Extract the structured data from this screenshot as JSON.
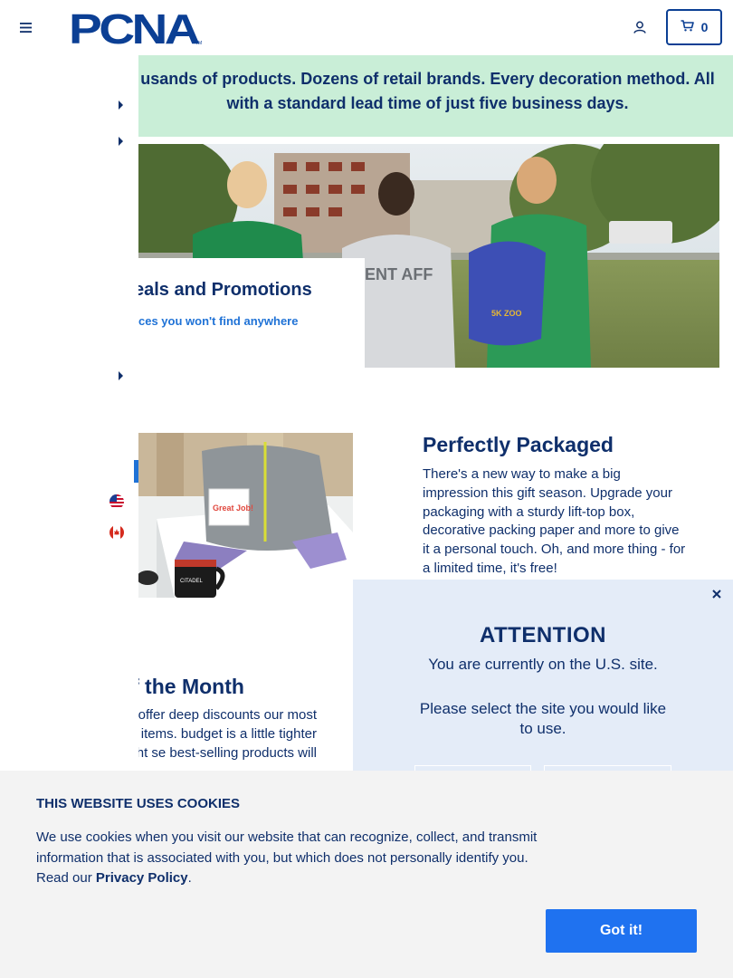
{
  "header": {
    "brand": "PCNA",
    "cart_count": "0"
  },
  "banner": {
    "text": "usands of products. Dozens of retail brands. Every decoration method. All with a standard lead time of just five business days."
  },
  "hero": {
    "card_title": "eals and Promotions",
    "card_link": "ces you won't find anywhere",
    "jacket_text": "ENT AFF",
    "bag_text": "5K ZOO"
  },
  "packaged": {
    "title": "Perfectly Packaged",
    "body": "There's a new way to make a big impression this gift season. Upgrade your packaging with a sturdy lift-top box, decorative packing paper and more to give it a personal touch. Oh, and more thing - for a limited time, it's free!",
    "card_text": "Great Job!",
    "mug_text": "CITADEL"
  },
  "month": {
    "title": "f the Month",
    "body": "we'll offer deep discounts our most popular items. budget is a little tighter right se best-selling products will"
  },
  "attention": {
    "title": "ATTENTION",
    "subtitle": "You are currently on the U.S. site.",
    "question": "Please select the site you would like to use."
  },
  "cookie": {
    "title": "THIS WEBSITE USES COOKIES",
    "text_before": "We use cookies when you visit our website that can recognize, collect, and transmit information that is associated with you, but which does not personally identify you. Read our ",
    "link": "Privacy Policy",
    "text_after": ".",
    "button": "Got it!"
  },
  "colors": {
    "navy": "#0f2f6b",
    "brand_blue": "#0b3f94",
    "link_blue": "#1f72d6",
    "banner_green": "#c9eed7",
    "button_blue": "#1f72f0"
  }
}
